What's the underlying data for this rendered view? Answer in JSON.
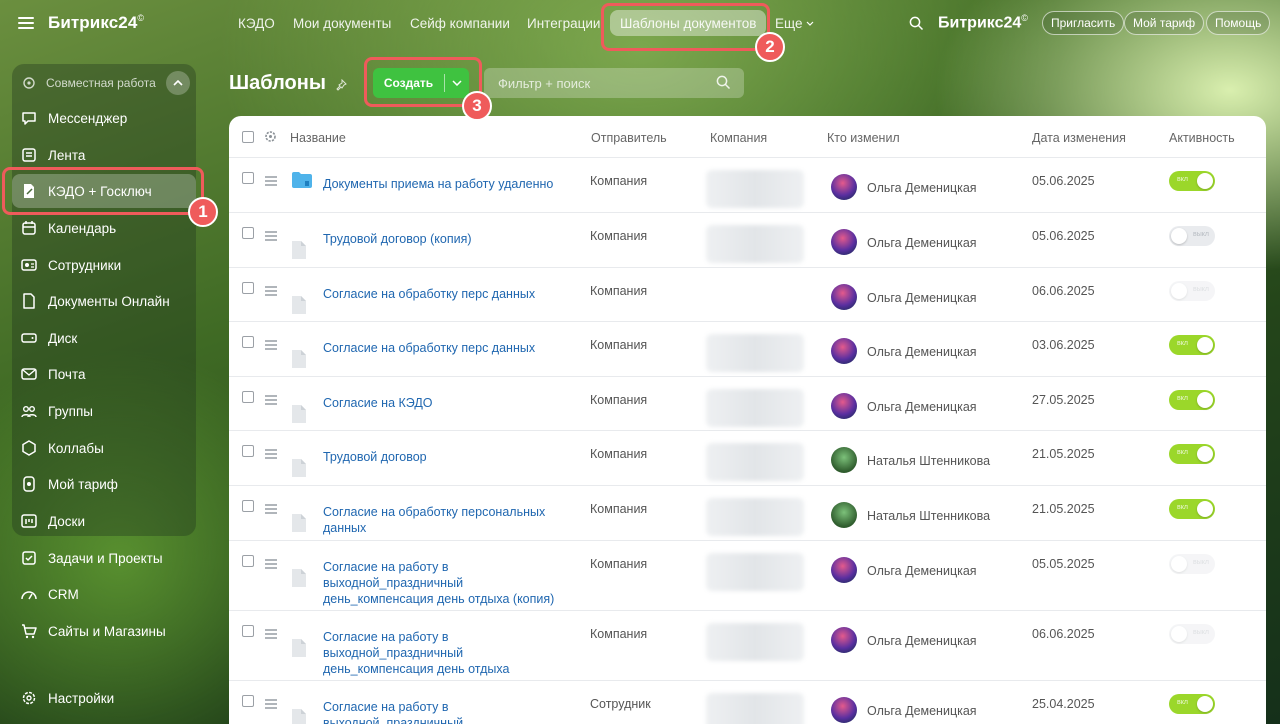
{
  "app": {
    "brand": "Битрикс24",
    "brand_mark": "©"
  },
  "sidebar": {
    "group_title": "Совместная работа",
    "items": [
      {
        "label": "Мессенджер",
        "icon": "chat-icon"
      },
      {
        "label": "Лента",
        "icon": "feed-icon"
      },
      {
        "label": "КЭДО + Госключ",
        "icon": "document-sign-icon",
        "active": true
      },
      {
        "label": "Календарь",
        "icon": "calendar-icon"
      },
      {
        "label": "Сотрудники",
        "icon": "employees-icon"
      },
      {
        "label": "Документы Онлайн",
        "icon": "docs-online-icon"
      },
      {
        "label": "Диск",
        "icon": "disk-icon"
      },
      {
        "label": "Почта",
        "icon": "mail-icon"
      },
      {
        "label": "Группы",
        "icon": "groups-icon"
      },
      {
        "label": "Коллабы",
        "icon": "collabs-icon"
      },
      {
        "label": "Мой тариф",
        "icon": "tariff-icon"
      },
      {
        "label": "Доски",
        "icon": "boards-icon"
      },
      {
        "label": "Задачи и Проекты",
        "icon": "tasks-icon"
      },
      {
        "label": "CRM",
        "icon": "crm-icon"
      },
      {
        "label": "Сайты и Магазины",
        "icon": "shop-icon"
      },
      {
        "label": "Настройки",
        "icon": "settings-icon"
      }
    ]
  },
  "topnav": {
    "items": [
      "КЭДО",
      "Мои документы",
      "Сейф компании",
      "Интеграции",
      "Шаблоны документов"
    ],
    "more": "Еще",
    "brand": "Битрикс24",
    "invite": "Пригласить",
    "tariff": "Мой тариф",
    "help": "Помощь"
  },
  "page": {
    "title": "Шаблоны",
    "create_label": "Создать",
    "search_placeholder": "Фильтр + поиск"
  },
  "annotations": {
    "one": "1",
    "two": "2",
    "three": "3"
  },
  "table": {
    "columns": {
      "name": "Название",
      "sender": "Отправитель",
      "company": "Компания",
      "editor": "Кто изменил",
      "date": "Дата изменения",
      "active": "Активность"
    },
    "toggle_on": "вкл",
    "toggle_off": "выкл",
    "rows": [
      {
        "name": "Документы приема на работу удаленно",
        "folder": true,
        "sender": "Компания",
        "editor": "Ольга Деменицкая",
        "date": "05.06.2025",
        "active": true
      },
      {
        "name": "Трудовой договор (копия)",
        "sender": "Компания",
        "editor": "Ольга Деменицкая",
        "date": "05.06.2025",
        "active": false
      },
      {
        "name": "Согласие на обработку перс данных",
        "sender": "Компания",
        "editor": "Ольга Деменицкая",
        "date": "06.06.2025",
        "active": false
      },
      {
        "name": "Согласие на обработку перс данных",
        "sender": "Компания",
        "editor": "Ольга Деменицкая",
        "date": "03.06.2025",
        "active": true
      },
      {
        "name": "Согласие на КЭДО",
        "sender": "Компания",
        "editor": "Ольга Деменицкая",
        "date": "27.05.2025",
        "active": true
      },
      {
        "name": "Трудовой договор",
        "sender": "Компания",
        "editor": "Наталья Штенникова",
        "date": "21.05.2025",
        "active": true
      },
      {
        "name": "Согласие на обработку персональных данных",
        "sender": "Компания",
        "editor": "Наталья Штенникова",
        "date": "21.05.2025",
        "active": true
      },
      {
        "name": "Согласие на работу в выходной_праздничный день_компенсация день отдыха (копия)",
        "sender": "Компания",
        "editor": "Ольга Деменицкая",
        "date": "05.05.2025",
        "active": false
      },
      {
        "name": "Согласие на работу в выходной_праздничный день_компенсация день отдыха",
        "sender": "Компания",
        "editor": "Ольга Деменицкая",
        "date": "06.06.2025",
        "active": false
      },
      {
        "name": "Согласие на работу в выходной_праздничный день_компенсация день отдыха",
        "sender": "Сотрудник",
        "editor": "Ольга Деменицкая",
        "date": "25.04.2025",
        "active": true
      }
    ]
  }
}
